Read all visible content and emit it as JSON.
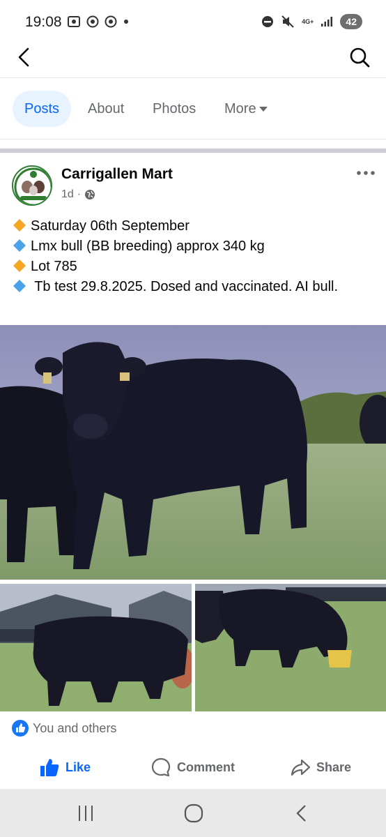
{
  "status_bar": {
    "time": "19:08",
    "network": "4G+",
    "battery": "42"
  },
  "tabs": [
    {
      "label": "Posts",
      "active": true
    },
    {
      "label": "About",
      "active": false
    },
    {
      "label": "Photos",
      "active": false
    },
    {
      "label": "More",
      "active": false
    }
  ],
  "post": {
    "page_name": "Carrigallen Mart",
    "age": "1d",
    "privacy_icon": "globe-icon",
    "lines": [
      {
        "bullet": "orange-diamond",
        "text": "Saturday 06th September"
      },
      {
        "bullet": "blue-diamond",
        "text": "Lmx bull (BB breeding) approx 340 kg"
      },
      {
        "bullet": "orange-diamond",
        "text": "Lot 785"
      },
      {
        "bullet": "blue-diamond",
        "text": " Tb test 29.8.2025. Dosed and vaccinated. AI bull."
      }
    ],
    "reactions": "You and others",
    "actions": {
      "like": "Like",
      "comment": "Comment",
      "share": "Share"
    }
  },
  "colors": {
    "accent": "#0866ff",
    "secondary_text": "#65676b",
    "orange_diamond": "#f5a623",
    "blue_diamond": "#4aa3e8"
  }
}
